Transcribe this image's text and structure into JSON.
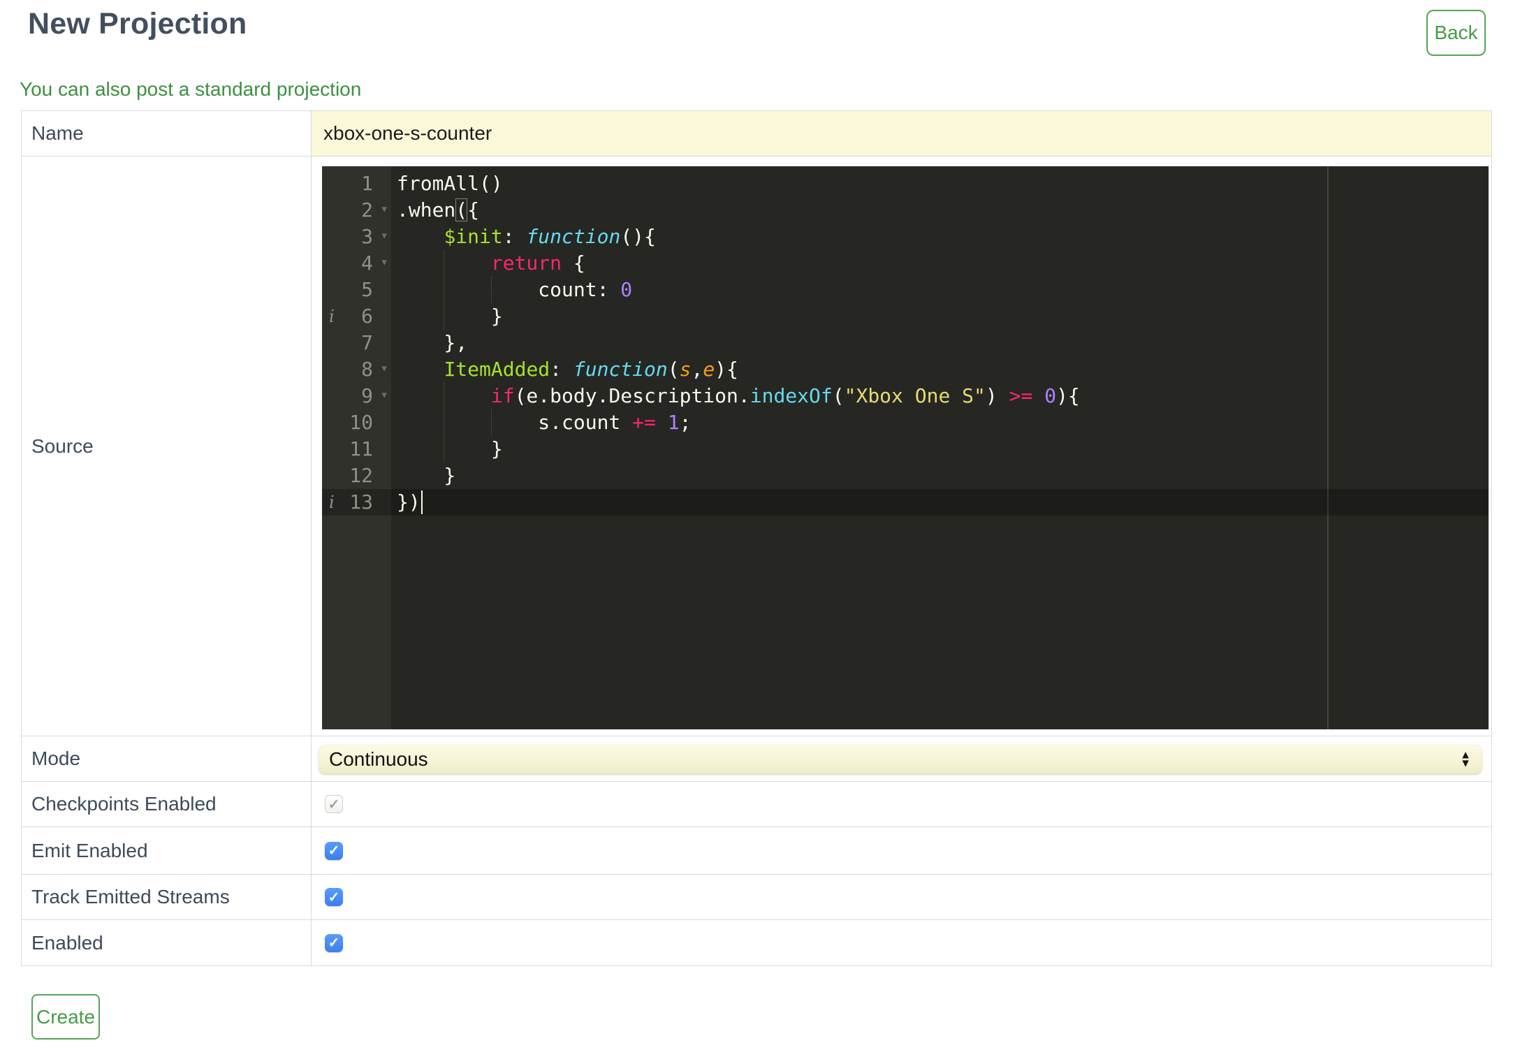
{
  "header": {
    "title": "New Projection",
    "back_label": "Back"
  },
  "link_text": "You can also post a standard projection",
  "form": {
    "rows": {
      "name": {
        "label": "Name",
        "value": "xbox-one-s-counter"
      },
      "source": {
        "label": "Source"
      },
      "mode": {
        "label": "Mode",
        "value": "Continuous"
      },
      "checkpoints": {
        "label": "Checkpoints Enabled",
        "checked": true,
        "disabled": true
      },
      "emit": {
        "label": "Emit Enabled",
        "checked": true,
        "disabled": false
      },
      "track": {
        "label": "Track Emitted Streams",
        "checked": true,
        "disabled": false
      },
      "enabled": {
        "label": "Enabled",
        "checked": true,
        "disabled": false
      }
    },
    "create_label": "Create",
    "checkmark_glyph": "✓",
    "select_arrow_up": "▲",
    "select_arrow_down": "▼"
  },
  "colors": {
    "accent_green": "#479b48",
    "link_green": "#3e8f42",
    "input_yellow": "#fbf8d9",
    "checkbox_blue": "#3a7ef2",
    "editor_background": "#262722",
    "editor_gutter": "#30312b",
    "syntax_green": "#a6e22e",
    "syntax_cyan": "#66d9ef",
    "syntax_pink": "#f92672",
    "syntax_purple": "#ae81ff",
    "syntax_yellow": "#e6db74",
    "syntax_orange": "#fd971f"
  },
  "editor": {
    "active_line": 13,
    "fold_glyph": "▾",
    "info_glyph": "i",
    "lines": [
      {
        "num": 1,
        "tokens": [
          [
            "w",
            "fromAll()"
          ]
        ]
      },
      {
        "num": 2,
        "fold": true,
        "tokens": [
          [
            "w",
            ".when"
          ],
          [
            "m",
            "("
          ],
          [
            "w",
            "{"
          ]
        ]
      },
      {
        "num": 3,
        "fold": true,
        "tokens": [
          [
            "w",
            "    "
          ],
          [
            "g",
            "$init"
          ],
          [
            "w",
            ": "
          ],
          [
            "c",
            "function"
          ],
          [
            "w",
            "(){"
          ]
        ]
      },
      {
        "num": 4,
        "fold": true,
        "tokens": [
          [
            "w",
            "        "
          ],
          [
            "p",
            "return"
          ],
          [
            "w",
            " {"
          ]
        ]
      },
      {
        "num": 5,
        "tokens": [
          [
            "w",
            "            count: "
          ],
          [
            "n",
            "0"
          ]
        ]
      },
      {
        "num": 6,
        "info": true,
        "tokens": [
          [
            "w",
            "        }"
          ]
        ]
      },
      {
        "num": 7,
        "tokens": [
          [
            "w",
            "    },"
          ]
        ]
      },
      {
        "num": 8,
        "fold": true,
        "tokens": [
          [
            "w",
            "    "
          ],
          [
            "g",
            "ItemAdded"
          ],
          [
            "w",
            ": "
          ],
          [
            "c",
            "function"
          ],
          [
            "w",
            "("
          ],
          [
            "o",
            "s"
          ],
          [
            "w",
            ","
          ],
          [
            "o",
            "e"
          ],
          [
            "w",
            "){"
          ]
        ]
      },
      {
        "num": 9,
        "fold": true,
        "tokens": [
          [
            "w",
            "        "
          ],
          [
            "p",
            "if"
          ],
          [
            "w",
            "(e.body.Description."
          ],
          [
            "cy",
            "indexOf"
          ],
          [
            "w",
            "("
          ],
          [
            "s",
            "\"Xbox One S\""
          ],
          [
            "w",
            ") "
          ],
          [
            "p",
            ">="
          ],
          [
            "w",
            " "
          ],
          [
            "n",
            "0"
          ],
          [
            "w",
            "){"
          ]
        ]
      },
      {
        "num": 10,
        "tokens": [
          [
            "w",
            "            s.count "
          ],
          [
            "p",
            "+="
          ],
          [
            "w",
            " "
          ],
          [
            "n",
            "1"
          ],
          [
            "w",
            ";"
          ]
        ]
      },
      {
        "num": 11,
        "tokens": [
          [
            "w",
            "        }"
          ]
        ]
      },
      {
        "num": 12,
        "tokens": [
          [
            "w",
            "    }"
          ]
        ]
      },
      {
        "num": 13,
        "info": true,
        "tokens": [
          [
            "w",
            "})"
          ]
        ]
      }
    ]
  }
}
